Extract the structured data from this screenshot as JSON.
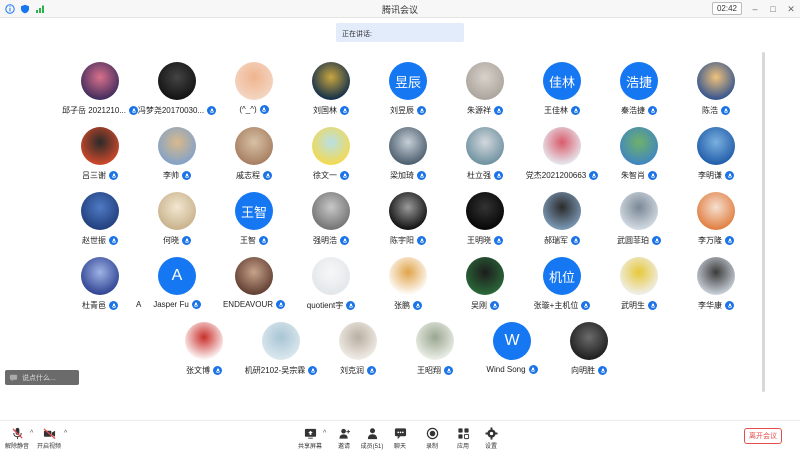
{
  "window": {
    "title": "腾讯会议",
    "timer": "02:42"
  },
  "speaking_label": "正在讲话:",
  "participants": [
    {
      "name": "邱子岳 2021210...",
      "avatar": "anime"
    },
    {
      "name": "冯梦尧20170030...",
      "avatar": "moon"
    },
    {
      "name": "(^_^)",
      "avatar": "child"
    },
    {
      "name": "刘国林",
      "avatar": "poster"
    },
    {
      "name": "刘昱辰",
      "avatar_text": "昱辰"
    },
    {
      "name": "朱源祥",
      "avatar": "photo-grey"
    },
    {
      "name": "王佳林",
      "avatar_text": "佳林"
    },
    {
      "name": "秦浩捷",
      "avatar_text": "浩捷"
    },
    {
      "name": "陈浩",
      "avatar": "cartoon-man"
    },
    {
      "name": "吕三谢",
      "avatar": "character"
    },
    {
      "name": "李帅",
      "avatar": "landscape"
    },
    {
      "name": "戚志程",
      "avatar": "building"
    },
    {
      "name": "徐文一",
      "avatar": "yellow-bear"
    },
    {
      "name": "梁加琦",
      "avatar": "group"
    },
    {
      "name": "杜立强",
      "avatar": "scenery"
    },
    {
      "name": "党杰2021200663",
      "avatar": "flowers"
    },
    {
      "name": "朱智肖",
      "avatar": "court"
    },
    {
      "name": "李明谦",
      "avatar": "blue-sky"
    },
    {
      "name": "赵世振",
      "avatar": "dragon"
    },
    {
      "name": "何晓",
      "avatar": "sketch"
    },
    {
      "name": "王智",
      "avatar_text": "王智"
    },
    {
      "name": "强明浩",
      "avatar": "lion"
    },
    {
      "name": "陈宇阳",
      "avatar": "night-moon"
    },
    {
      "name": "王明晓",
      "avatar": "power"
    },
    {
      "name": "郝瑞军",
      "avatar": "person"
    },
    {
      "name": "武圆菲珀",
      "avatar": "snow-tree"
    },
    {
      "name": "李万隆",
      "avatar": "anime-orange"
    },
    {
      "name": "杜青邑",
      "avatar": "blue-art"
    },
    {
      "name": "Jasper Fu",
      "avatar_text": "A"
    },
    {
      "name": "ENDEAVOUR",
      "avatar": "anime-girl"
    },
    {
      "name": "quotient宇",
      "avatar": "cat-white"
    },
    {
      "name": "张鹏",
      "avatar": "doge"
    },
    {
      "name": "吴刚",
      "avatar": "jersey"
    },
    {
      "name": "张璇+主机位",
      "avatar_text": "机位"
    },
    {
      "name": "武明生",
      "avatar": "balloon"
    },
    {
      "name": "李华康",
      "avatar": "anime-man"
    },
    {
      "name": "张文博",
      "avatar": "penguin"
    },
    {
      "name": "机研2102-吴宗霖",
      "avatar": "lying"
    },
    {
      "name": "刘克润",
      "avatar": "cat"
    },
    {
      "name": "王昭翔",
      "avatar": "sketch-pale"
    },
    {
      "name": "Wind Song",
      "avatar_text": "W"
    },
    {
      "name": "向明胜",
      "avatar": "dark-person"
    }
  ],
  "extra_label": "A",
  "chat_placeholder": "说点什么...",
  "toolbar": {
    "unmute": "解除静音",
    "start_video": "开启视频",
    "share_screen": "共享屏幕",
    "invite": "邀请",
    "members": "成员(51)",
    "chat": "聊天",
    "record": "录制",
    "apps": "应用",
    "settings": "设置",
    "leave": "离开会议"
  },
  "colors": {
    "accent": "#1677f2",
    "leave": "#e34d4d"
  }
}
